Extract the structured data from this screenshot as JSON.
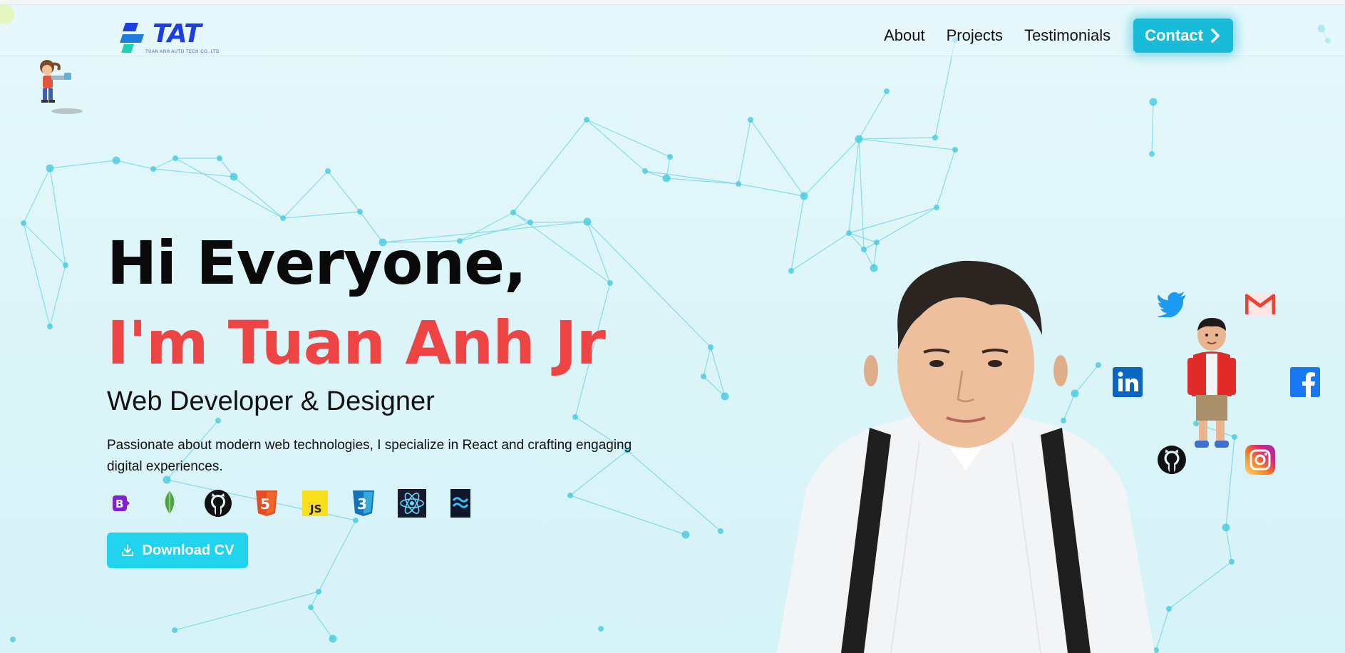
{
  "header": {
    "logo_text": "TAT",
    "logo_subtitle": "TUAN ANH AUTO TECH CO.,LTD",
    "nav": [
      "About",
      "Projects",
      "Testimonials"
    ],
    "contact_label": "Contact"
  },
  "hero": {
    "greeting": "Hi Everyone,",
    "name_line": "I'm Tuan Anh Jr",
    "role": "Web Developer & Designer",
    "description": "Passionate about modern web technologies, I specialize in React and crafting engaging digital experiences.",
    "tech_icons": [
      "bootstrap-icon",
      "mongodb-icon",
      "github-icon",
      "html5-icon",
      "javascript-icon",
      "css3-icon",
      "react-icon",
      "tailwind-icon"
    ],
    "download_label": "Download CV"
  },
  "socials": [
    "twitter-icon",
    "gmail-icon",
    "linkedin-icon",
    "facebook-icon",
    "github-icon",
    "instagram-icon"
  ],
  "colors": {
    "accent": "#19bcd8",
    "name": "#ef4444",
    "background": "#dff6f9",
    "network": "#3cc8dc"
  }
}
